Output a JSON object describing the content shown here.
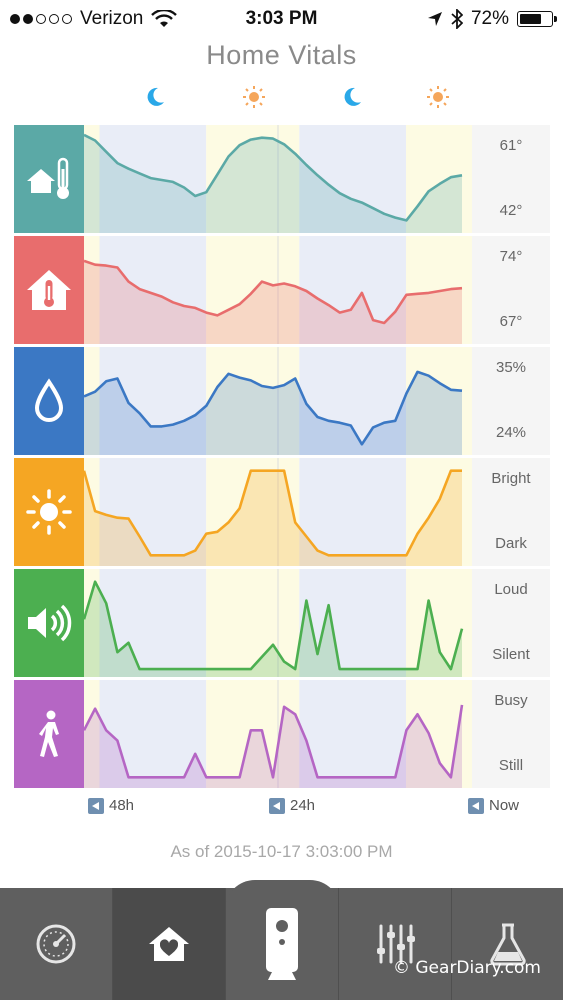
{
  "status_bar": {
    "carrier": "Verizon",
    "time": "3:03 PM",
    "battery": "72%",
    "battery_level": 0.72,
    "signal_bars_filled": 2,
    "signal_bars_total": 5
  },
  "page_title": "Home Vitals",
  "cycle_icons": [
    "moon-icon",
    "sun-icon",
    "moon-icon",
    "sun-icon"
  ],
  "colors": {
    "outdoor_temp": "#5ba9a6",
    "indoor_temp": "#e86d6d",
    "humidity": "#3b78c4",
    "light": "#f5a623",
    "sound": "#4caf50",
    "motion": "#b566c4",
    "night_band": "#e9edf7",
    "day_band": "#fdfbe3"
  },
  "rows": [
    {
      "id": "outdoor-temp",
      "icon": "outdoor-temperature-icon",
      "top_label": "61°",
      "bottom_label": "42°",
      "values": [
        0.98,
        0.92,
        0.8,
        0.68,
        0.62,
        0.57,
        0.52,
        0.5,
        0.48,
        0.42,
        0.33,
        0.37,
        0.56,
        0.75,
        0.87,
        0.93,
        0.95,
        0.94,
        0.88,
        0.78,
        0.66,
        0.55,
        0.45,
        0.36,
        0.3,
        0.26,
        0.2,
        0.14,
        0.1,
        0.07,
        0.22,
        0.38,
        0.46,
        0.53,
        0.55
      ]
    },
    {
      "id": "indoor-temp",
      "icon": "indoor-temperature-icon",
      "top_label": "74°",
      "bottom_label": "67°",
      "values": [
        0.82,
        0.78,
        0.77,
        0.75,
        0.6,
        0.52,
        0.48,
        0.44,
        0.38,
        0.34,
        0.32,
        0.27,
        0.24,
        0.3,
        0.36,
        0.47,
        0.6,
        0.56,
        0.58,
        0.55,
        0.5,
        0.42,
        0.35,
        0.27,
        0.3,
        0.48,
        0.19,
        0.16,
        0.28,
        0.46,
        0.47,
        0.48,
        0.5,
        0.52,
        0.53
      ]
    },
    {
      "id": "humidity",
      "icon": "humidity-drop-icon",
      "top_label": "35%",
      "bottom_label": "24%",
      "values": [
        0.56,
        0.61,
        0.72,
        0.75,
        0.49,
        0.38,
        0.24,
        0.24,
        0.26,
        0.3,
        0.36,
        0.46,
        0.66,
        0.8,
        0.76,
        0.73,
        0.67,
        0.65,
        0.68,
        0.75,
        0.48,
        0.34,
        0.3,
        0.28,
        0.25,
        0.05,
        0.23,
        0.28,
        0.3,
        0.59,
        0.82,
        0.78,
        0.7,
        0.63,
        0.62
      ]
    },
    {
      "id": "light",
      "icon": "sun-light-icon",
      "top_label": "Bright",
      "bottom_label": "Dark",
      "values": [
        0.95,
        0.52,
        0.48,
        0.45,
        0.44,
        0.25,
        0.05,
        0.05,
        0.05,
        0.05,
        0.1,
        0.28,
        0.3,
        0.4,
        0.55,
        0.95,
        0.95,
        0.95,
        0.95,
        0.4,
        0.25,
        0.1,
        0.05,
        0.05,
        0.05,
        0.05,
        0.05,
        0.05,
        0.05,
        0.05,
        0.28,
        0.45,
        0.65,
        0.95,
        0.95
      ]
    },
    {
      "id": "sound",
      "icon": "speaker-sound-icon",
      "top_label": "Loud",
      "bottom_label": "Silent",
      "values": [
        0.55,
        0.95,
        0.72,
        0.2,
        0.3,
        0.02,
        0.02,
        0.02,
        0.02,
        0.02,
        0.02,
        0.02,
        0.02,
        0.02,
        0.02,
        0.02,
        0.15,
        0.28,
        0.1,
        0.02,
        0.75,
        0.18,
        0.7,
        0.02,
        0.02,
        0.02,
        0.02,
        0.02,
        0.02,
        0.02,
        0.02,
        0.75,
        0.2,
        0.02,
        0.45
      ]
    },
    {
      "id": "motion",
      "icon": "walking-person-icon",
      "top_label": "Busy",
      "bottom_label": "Still",
      "values": [
        0.55,
        0.78,
        0.55,
        0.44,
        0.05,
        0.05,
        0.05,
        0.05,
        0.05,
        0.05,
        0.3,
        0.05,
        0.05,
        0.05,
        0.05,
        0.55,
        0.55,
        0.05,
        0.8,
        0.72,
        0.44,
        0.05,
        0.05,
        0.05,
        0.05,
        0.05,
        0.05,
        0.05,
        0.05,
        0.55,
        0.72,
        0.52,
        0.2,
        0.05,
        0.82
      ]
    }
  ],
  "bands": [
    {
      "type": "night",
      "from": 0.04,
      "to": 0.315
    },
    {
      "type": "day",
      "from": 0.315,
      "to": 0.555
    },
    {
      "type": "night",
      "from": 0.555,
      "to": 0.83
    },
    {
      "type": "day",
      "from": 0.83,
      "to": 1.0
    }
  ],
  "time_axis": {
    "left": "48h",
    "middle": "24h",
    "right": "Now"
  },
  "as_of": "As of 2015-10-17 3:03:00 PM",
  "tabs": [
    {
      "id": "dashboard",
      "icon": "gauge-icon"
    },
    {
      "id": "home",
      "icon": "home-heart-icon",
      "active": true
    },
    {
      "id": "camera",
      "icon": "camera-device-icon"
    },
    {
      "id": "settings",
      "icon": "sliders-icon"
    },
    {
      "id": "lab",
      "icon": "flask-icon"
    }
  ],
  "watermark": "© GearDiary.com"
}
